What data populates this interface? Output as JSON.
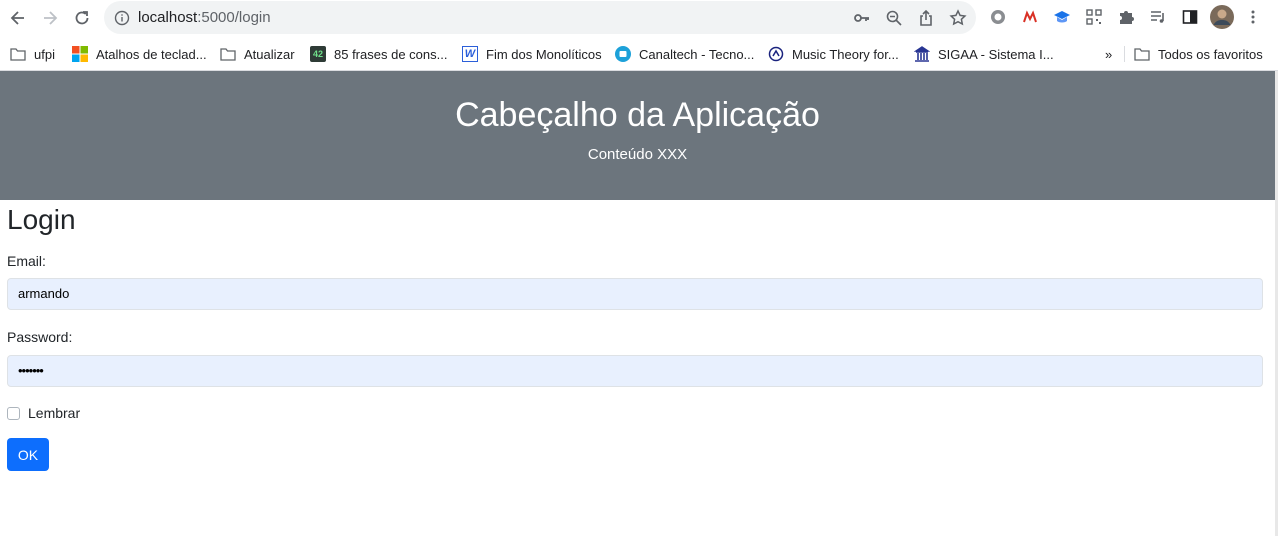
{
  "browser": {
    "url_host": "localhost",
    "url_rest": ":5000/login"
  },
  "bookmarks": [
    {
      "label": "ufpi",
      "icon": "folder-icon"
    },
    {
      "label": "Atalhos de teclad...",
      "icon": "microsoft-icon"
    },
    {
      "label": "Atualizar",
      "icon": "folder-icon"
    },
    {
      "label": "85 frases de cons...",
      "icon": "42-icon",
      "icon_text": "42"
    },
    {
      "label": "Fim dos Monolíticos",
      "icon": "w-icon",
      "icon_text": "W"
    },
    {
      "label": "Canaltech - Tecno...",
      "icon": "canaltech-icon"
    },
    {
      "label": "Music Theory for...",
      "icon": "music-theory-icon"
    },
    {
      "label": "SIGAA - Sistema I...",
      "icon": "sigaa-icon"
    },
    {
      "label": "Todos os favoritos",
      "icon": "folder-icon"
    }
  ],
  "bookmarks_overflow": "»",
  "header": {
    "title": "Cabeçalho da Aplicação",
    "subtitle": "Conteúdo XXX"
  },
  "form": {
    "title": "Login",
    "email_label": "Email:",
    "email_value": "armando",
    "password_label": "Password:",
    "password_value": "•••••••",
    "remember_label": "Lembrar",
    "remember_checked": false,
    "submit_label": "OK"
  },
  "colors": {
    "header_bg": "#6c757d",
    "button_bg": "#0d6efd",
    "autofill_bg": "#e8f0fe"
  }
}
